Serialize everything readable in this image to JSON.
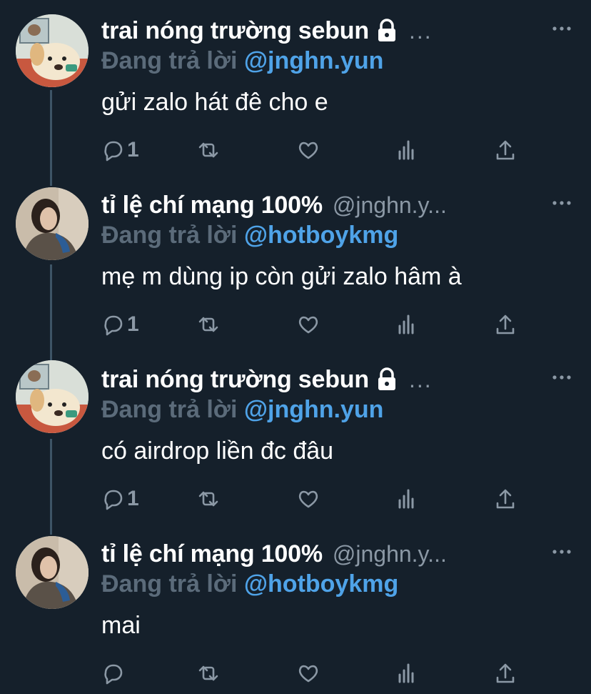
{
  "colors": {
    "background": "#15202b",
    "text_primary": "#ffffff",
    "text_secondary": "#8b98a5",
    "reply_prefix": "#5b6b7a",
    "mention": "#4fa3e8",
    "thread_line": "#3d5466"
  },
  "tweets": [
    {
      "display_name": "trai nóng trường sebun",
      "handle": "",
      "show_lock": true,
      "trailing_ellipsis": "...",
      "reply_prefix": "Đang trả lời",
      "reply_to": "@jnghn.yun",
      "text": "gửi zalo hát đê cho e",
      "reply_count": "1",
      "avatar_icon": "dog-cartoon-avatar"
    },
    {
      "display_name": "tỉ lệ chí mạng 100%",
      "handle": "@jnghn.y...",
      "show_lock": false,
      "trailing_ellipsis": "",
      "reply_prefix": "Đang trả lời",
      "reply_to": "@hotboykmg",
      "text": "mẹ m dùng ip còn gửi zalo hâm à",
      "reply_count": "1",
      "avatar_icon": "person-photo-avatar"
    },
    {
      "display_name": "trai nóng trường sebun",
      "handle": "",
      "show_lock": true,
      "trailing_ellipsis": "...",
      "reply_prefix": "Đang trả lời",
      "reply_to": "@jnghn.yun",
      "text": "có airdrop liền đc đâu",
      "reply_count": "1",
      "avatar_icon": "dog-cartoon-avatar"
    },
    {
      "display_name": "tỉ lệ chí mạng 100%",
      "handle": "@jnghn.y...",
      "show_lock": false,
      "trailing_ellipsis": "",
      "reply_prefix": "Đang trả lời",
      "reply_to": "@hotboykmg",
      "text": "mai",
      "reply_count": "",
      "avatar_icon": "person-photo-avatar"
    }
  ]
}
